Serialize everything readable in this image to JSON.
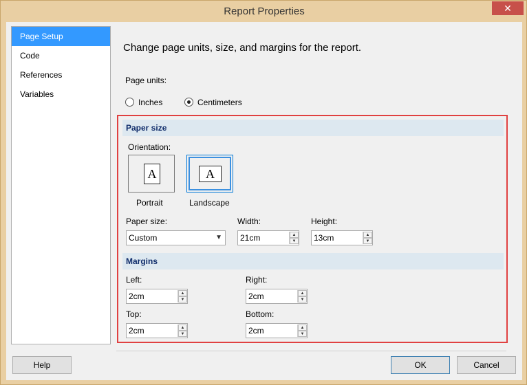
{
  "window": {
    "title": "Report Properties",
    "close_glyph": "✕"
  },
  "sidebar": {
    "items": [
      {
        "label": "Page Setup"
      },
      {
        "label": "Code"
      },
      {
        "label": "References"
      },
      {
        "label": "Variables"
      }
    ]
  },
  "main": {
    "heading": "Change page units, size, and margins for the report.",
    "page_units_label": "Page units:",
    "units": {
      "inches": "Inches",
      "centimeters": "Centimeters",
      "selected": "Centimeters"
    },
    "paper_size_section": "Paper size",
    "orientation_label": "Orientation:",
    "orientation": {
      "portrait": "Portrait",
      "landscape": "Landscape",
      "selected": "Landscape",
      "doc_glyph": "A"
    },
    "paper_size_label": "Paper size:",
    "paper_size_value": "Custom",
    "width_label": "Width:",
    "width_value": "21cm",
    "height_label": "Height:",
    "height_value": "13cm",
    "margins_section": "Margins",
    "left_label": "Left:",
    "left_value": "2cm",
    "right_label": "Right:",
    "right_value": "2cm",
    "top_label": "Top:",
    "top_value": "2cm",
    "bottom_label": "Bottom:",
    "bottom_value": "2cm"
  },
  "footer": {
    "help": "Help",
    "ok": "OK",
    "cancel": "Cancel"
  },
  "colors": {
    "highlight_border": "#e04040",
    "selection": "#3399ff",
    "section_header_text": "#102d6b"
  }
}
